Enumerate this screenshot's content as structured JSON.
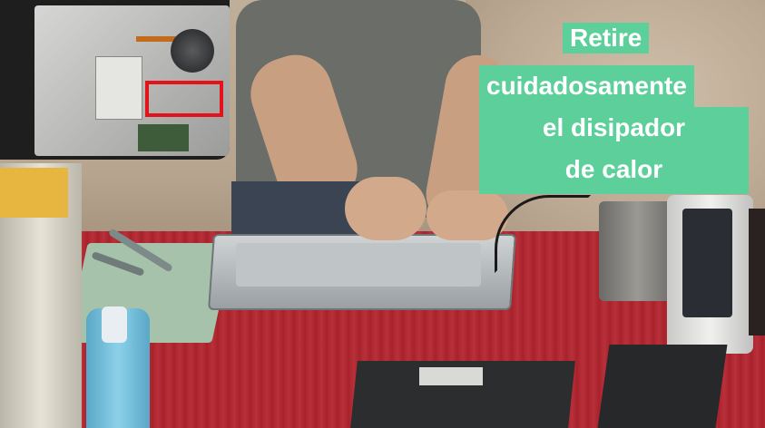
{
  "caption": {
    "lines": [
      "Retire",
      "cuidadosamente",
      "el disipador",
      "de calor"
    ]
  },
  "colors": {
    "caption_bg": "#5ccf9b",
    "caption_text": "#ffffff",
    "highlight_box": "#e3121b"
  },
  "inset": {
    "description_icon": "laptop-motherboard-photo"
  }
}
